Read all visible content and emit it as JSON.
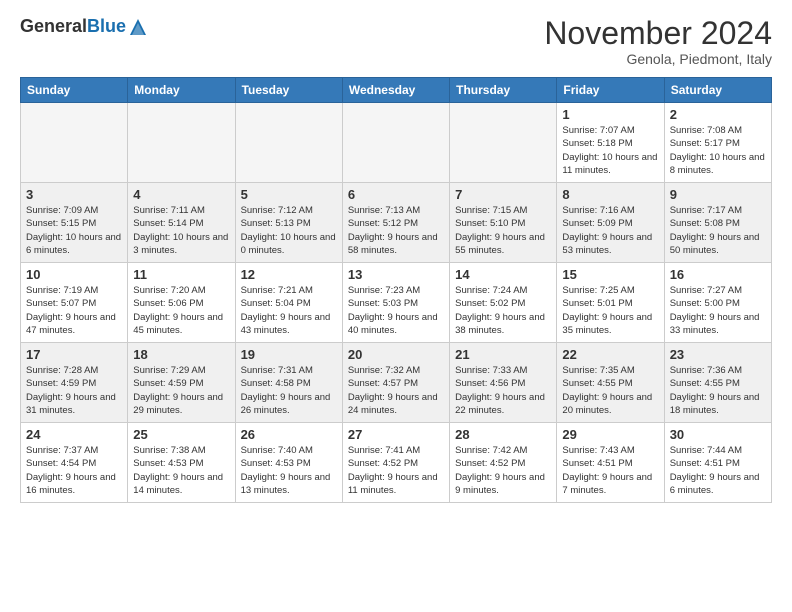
{
  "header": {
    "logo_general": "General",
    "logo_blue": "Blue",
    "month_title": "November 2024",
    "location": "Genola, Piedmont, Italy"
  },
  "weekdays": [
    "Sunday",
    "Monday",
    "Tuesday",
    "Wednesday",
    "Thursday",
    "Friday",
    "Saturday"
  ],
  "weeks": [
    [
      {
        "day": "",
        "info": ""
      },
      {
        "day": "",
        "info": ""
      },
      {
        "day": "",
        "info": ""
      },
      {
        "day": "",
        "info": ""
      },
      {
        "day": "",
        "info": ""
      },
      {
        "day": "1",
        "info": "Sunrise: 7:07 AM\nSunset: 5:18 PM\nDaylight: 10 hours and 11 minutes."
      },
      {
        "day": "2",
        "info": "Sunrise: 7:08 AM\nSunset: 5:17 PM\nDaylight: 10 hours and 8 minutes."
      }
    ],
    [
      {
        "day": "3",
        "info": "Sunrise: 7:09 AM\nSunset: 5:15 PM\nDaylight: 10 hours and 6 minutes."
      },
      {
        "day": "4",
        "info": "Sunrise: 7:11 AM\nSunset: 5:14 PM\nDaylight: 10 hours and 3 minutes."
      },
      {
        "day": "5",
        "info": "Sunrise: 7:12 AM\nSunset: 5:13 PM\nDaylight: 10 hours and 0 minutes."
      },
      {
        "day": "6",
        "info": "Sunrise: 7:13 AM\nSunset: 5:12 PM\nDaylight: 9 hours and 58 minutes."
      },
      {
        "day": "7",
        "info": "Sunrise: 7:15 AM\nSunset: 5:10 PM\nDaylight: 9 hours and 55 minutes."
      },
      {
        "day": "8",
        "info": "Sunrise: 7:16 AM\nSunset: 5:09 PM\nDaylight: 9 hours and 53 minutes."
      },
      {
        "day": "9",
        "info": "Sunrise: 7:17 AM\nSunset: 5:08 PM\nDaylight: 9 hours and 50 minutes."
      }
    ],
    [
      {
        "day": "10",
        "info": "Sunrise: 7:19 AM\nSunset: 5:07 PM\nDaylight: 9 hours and 47 minutes."
      },
      {
        "day": "11",
        "info": "Sunrise: 7:20 AM\nSunset: 5:06 PM\nDaylight: 9 hours and 45 minutes."
      },
      {
        "day": "12",
        "info": "Sunrise: 7:21 AM\nSunset: 5:04 PM\nDaylight: 9 hours and 43 minutes."
      },
      {
        "day": "13",
        "info": "Sunrise: 7:23 AM\nSunset: 5:03 PM\nDaylight: 9 hours and 40 minutes."
      },
      {
        "day": "14",
        "info": "Sunrise: 7:24 AM\nSunset: 5:02 PM\nDaylight: 9 hours and 38 minutes."
      },
      {
        "day": "15",
        "info": "Sunrise: 7:25 AM\nSunset: 5:01 PM\nDaylight: 9 hours and 35 minutes."
      },
      {
        "day": "16",
        "info": "Sunrise: 7:27 AM\nSunset: 5:00 PM\nDaylight: 9 hours and 33 minutes."
      }
    ],
    [
      {
        "day": "17",
        "info": "Sunrise: 7:28 AM\nSunset: 4:59 PM\nDaylight: 9 hours and 31 minutes."
      },
      {
        "day": "18",
        "info": "Sunrise: 7:29 AM\nSunset: 4:59 PM\nDaylight: 9 hours and 29 minutes."
      },
      {
        "day": "19",
        "info": "Sunrise: 7:31 AM\nSunset: 4:58 PM\nDaylight: 9 hours and 26 minutes."
      },
      {
        "day": "20",
        "info": "Sunrise: 7:32 AM\nSunset: 4:57 PM\nDaylight: 9 hours and 24 minutes."
      },
      {
        "day": "21",
        "info": "Sunrise: 7:33 AM\nSunset: 4:56 PM\nDaylight: 9 hours and 22 minutes."
      },
      {
        "day": "22",
        "info": "Sunrise: 7:35 AM\nSunset: 4:55 PM\nDaylight: 9 hours and 20 minutes."
      },
      {
        "day": "23",
        "info": "Sunrise: 7:36 AM\nSunset: 4:55 PM\nDaylight: 9 hours and 18 minutes."
      }
    ],
    [
      {
        "day": "24",
        "info": "Sunrise: 7:37 AM\nSunset: 4:54 PM\nDaylight: 9 hours and 16 minutes."
      },
      {
        "day": "25",
        "info": "Sunrise: 7:38 AM\nSunset: 4:53 PM\nDaylight: 9 hours and 14 minutes."
      },
      {
        "day": "26",
        "info": "Sunrise: 7:40 AM\nSunset: 4:53 PM\nDaylight: 9 hours and 13 minutes."
      },
      {
        "day": "27",
        "info": "Sunrise: 7:41 AM\nSunset: 4:52 PM\nDaylight: 9 hours and 11 minutes."
      },
      {
        "day": "28",
        "info": "Sunrise: 7:42 AM\nSunset: 4:52 PM\nDaylight: 9 hours and 9 minutes."
      },
      {
        "day": "29",
        "info": "Sunrise: 7:43 AM\nSunset: 4:51 PM\nDaylight: 9 hours and 7 minutes."
      },
      {
        "day": "30",
        "info": "Sunrise: 7:44 AM\nSunset: 4:51 PM\nDaylight: 9 hours and 6 minutes."
      }
    ]
  ]
}
